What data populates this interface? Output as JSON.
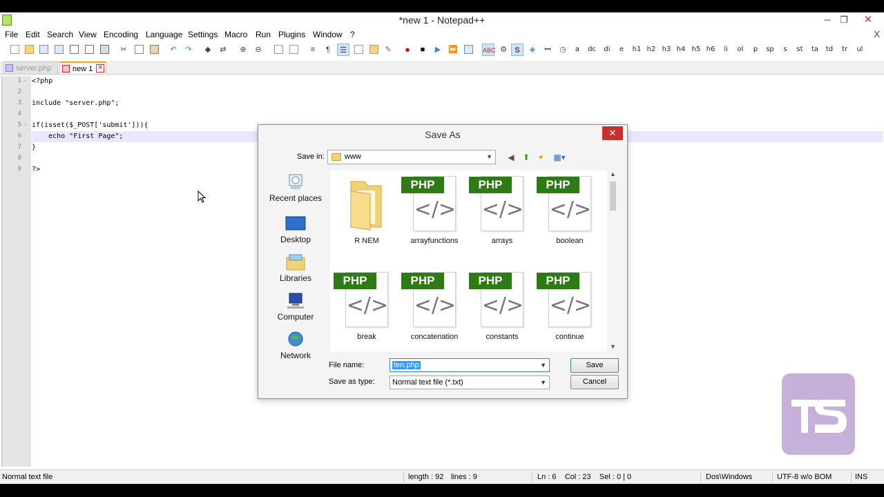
{
  "window": {
    "title": "*new  1 - Notepad++",
    "minimize": "─",
    "restore": "❐",
    "close": "✕"
  },
  "menu": {
    "items": [
      "File",
      "Edit",
      "Search",
      "View",
      "Encoding",
      "Language",
      "Settings",
      "Macro",
      "Run",
      "Plugins",
      "Window",
      "?"
    ],
    "close_x": "X"
  },
  "toolbar": {
    "tag_buttons": [
      "a",
      "dc",
      "di",
      "e",
      "h1",
      "h2",
      "h3",
      "h4",
      "h5",
      "h6",
      "li",
      "ol",
      "p",
      "sp",
      "s",
      "st",
      "ta",
      "td",
      "tr",
      "ul"
    ]
  },
  "tabs": [
    {
      "label": "server.php",
      "active": false
    },
    {
      "label": "new  1",
      "active": true
    }
  ],
  "editor": {
    "line_numbers": [
      "1",
      "2",
      "3",
      "4",
      "5",
      "6",
      "7",
      "8",
      "9"
    ],
    "lines": [
      "<?php",
      "",
      "include \"server.php\";",
      "",
      "if(isset($_POST['submit'])){",
      "    echo \"First Page\";",
      "}",
      "",
      "?>"
    ],
    "current_line": 6
  },
  "dialog": {
    "title": "Save As",
    "save_in_label": "Save in:",
    "save_in_value": "www",
    "places": [
      "Recent places",
      "Desktop",
      "Libraries",
      "Computer",
      "Network"
    ],
    "files": [
      {
        "name": "R NEM",
        "type": "folder"
      },
      {
        "name": "arrayfunctions",
        "type": "php"
      },
      {
        "name": "arrays",
        "type": "php"
      },
      {
        "name": "boolean",
        "type": "php"
      },
      {
        "name": "break",
        "type": "php"
      },
      {
        "name": "concatenation",
        "type": "php"
      },
      {
        "name": "constants",
        "type": "php"
      },
      {
        "name": "continue",
        "type": "php"
      }
    ],
    "php_badge": "PHP",
    "php_glyph": "</>",
    "file_name_label": "File name:",
    "file_name_value": "ten.php",
    "save_as_type_label": "Save as type:",
    "save_as_type_value": "Normal text file (*.txt)",
    "save_button": "Save",
    "cancel_button": "Cancel",
    "close": "✕"
  },
  "status": {
    "file_type": "Normal text file",
    "length": "length : 92",
    "lines": "lines : 9",
    "position": "Ln : 6    Col : 23    Sel : 0 | 0",
    "eol": "Dos\\Windows",
    "encoding": "UTF-8 w/o BOM",
    "mode": "INS"
  },
  "colors": {
    "php_badge_green": "#2e7a14",
    "dialog_close_red": "#c7302d",
    "selection_blue": "#3399ff",
    "watermark_purple": "#c0a8d6"
  }
}
